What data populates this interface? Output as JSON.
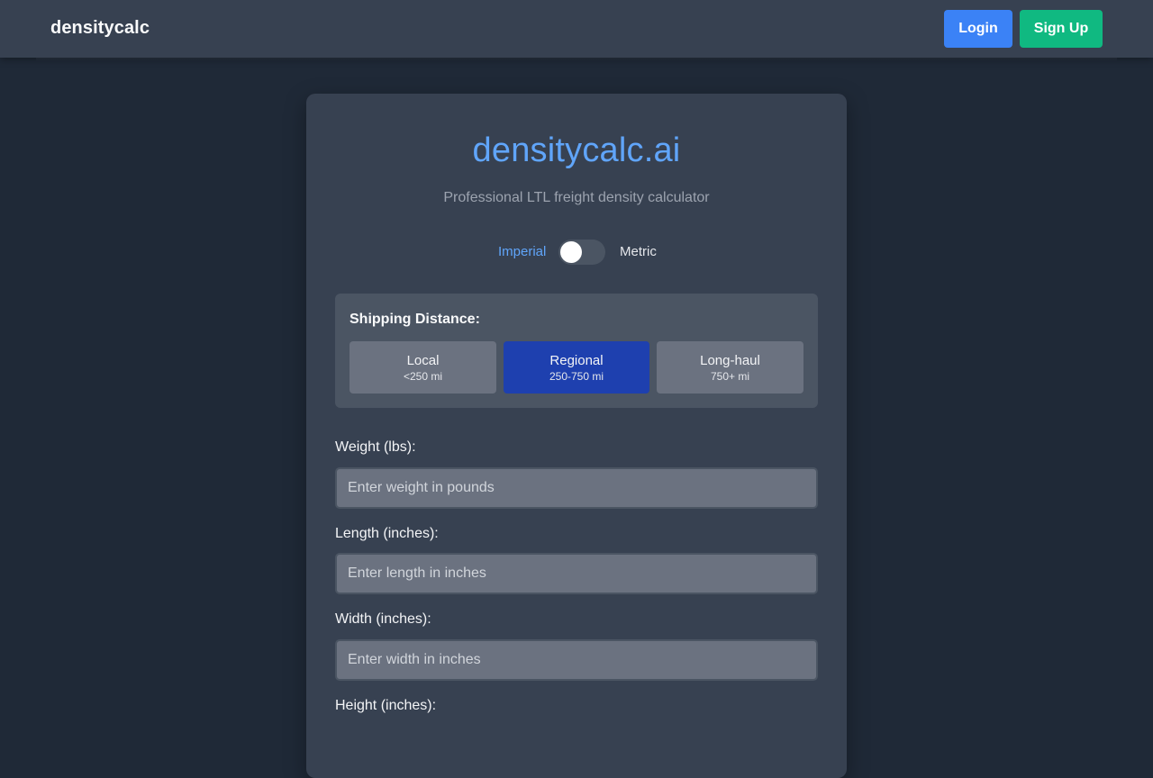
{
  "navbar": {
    "brand": "densitycalc",
    "login_label": "Login",
    "signup_label": "Sign Up"
  },
  "card": {
    "title": "densitycalc.ai",
    "subtitle": "Professional LTL freight density calculator"
  },
  "units": {
    "imperial_label": "Imperial",
    "metric_label": "Metric",
    "selected": "Imperial"
  },
  "distance": {
    "label": "Shipping Distance:",
    "options": [
      {
        "name": "Local",
        "range": "<250 mi",
        "selected": false
      },
      {
        "name": "Regional",
        "range": "250-750 mi",
        "selected": true
      },
      {
        "name": "Long-haul",
        "range": "750+ mi",
        "selected": false
      }
    ]
  },
  "fields": [
    {
      "label": "Weight (lbs):",
      "placeholder": "Enter weight in pounds",
      "value": ""
    },
    {
      "label": "Length (inches):",
      "placeholder": "Enter length in inches",
      "value": ""
    },
    {
      "label": "Width (inches):",
      "placeholder": "Enter width in inches",
      "value": ""
    },
    {
      "label": "Height (inches):",
      "placeholder": "",
      "value": ""
    }
  ],
  "colors": {
    "accent": "#60a5fa",
    "login_button": "#3b82f6",
    "signup_button": "#10b981",
    "selected_option": "#1e40af",
    "background": "#1f2937",
    "card": "#374151"
  }
}
